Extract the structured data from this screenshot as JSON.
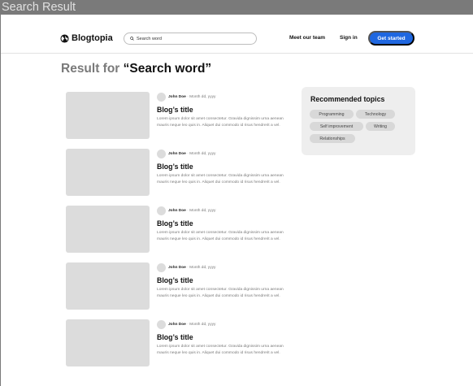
{
  "window": {
    "title": "Search Result"
  },
  "header": {
    "brand": "Blogtopia",
    "search": {
      "placeholder": "Search word",
      "value": ""
    },
    "nav": {
      "team": "Meet our team",
      "signin": "Sign in",
      "cta": "Get started"
    }
  },
  "results": {
    "prefix": "Result for",
    "term": "“Search word”",
    "posts": [
      {
        "author": "John Doe",
        "separator": " · ",
        "date": "Month dd, yyyy",
        "title": "Blog’s title",
        "excerpt": "Lorem ipsum dolor sit amet consectetur. Gravida dignissim urna aenean mauris neque leo quis in. Aliquet dui commodo id risus hendrerit a vel."
      },
      {
        "author": "John Doe",
        "separator": " · ",
        "date": "Month dd, yyyy",
        "title": "Blog’s title",
        "excerpt": "Lorem ipsum dolor sit amet consectetur. Gravida dignissim urna aenean mauris neque leo quis in. Aliquet dui commodo id risus hendrerit a vel."
      },
      {
        "author": "John Doe",
        "separator": " · ",
        "date": "Month dd, yyyy",
        "title": "Blog’s title",
        "excerpt": "Lorem ipsum dolor sit amet consectetur. Gravida dignissim urna aenean mauris neque leo quis in. Aliquet dui commodo id risus hendrerit a vel."
      },
      {
        "author": "John Doe",
        "separator": " · ",
        "date": "Month dd, yyyy",
        "title": "Blog’s title",
        "excerpt": "Lorem ipsum dolor sit amet consectetur. Gravida dignissim urna aenean mauris neque leo quis in. Aliquet dui commodo id risus hendrerit a vel."
      },
      {
        "author": "John Doe",
        "separator": " · ",
        "date": "Month dd, yyyy",
        "title": "Blog’s title",
        "excerpt": "Lorem ipsum dolor sit amet consectetur. Gravida dignissim urna aenean mauris neque leo quis in. Aliquet dui commodo id risus hendrerit a vel."
      }
    ]
  },
  "sidebar": {
    "title": "Recommended topics",
    "topics": [
      "Programming",
      "Technology",
      "Self improvement",
      "Writing",
      "Relationships"
    ]
  },
  "colors": {
    "accent": "#1f67e0",
    "placeholder": "#dcdcdc",
    "chip": "#d8d8d8",
    "sidebar_bg": "#eeeeee",
    "chrome": "#7a7a7a"
  },
  "icons": {
    "logo": "globe-icon",
    "search": "search-icon"
  }
}
